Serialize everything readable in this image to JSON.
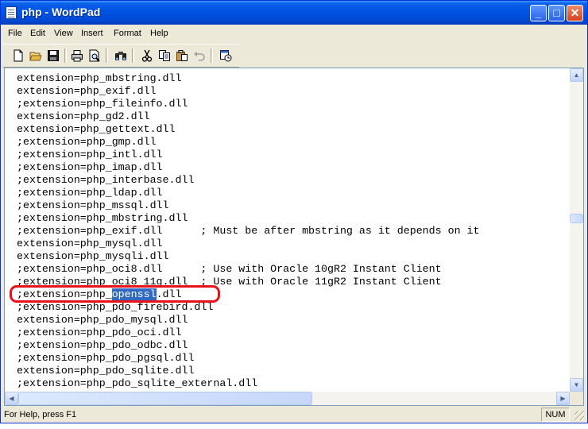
{
  "window": {
    "title": "php - WordPad"
  },
  "titlebar_buttons": {
    "minimize": "_",
    "maximize": "□",
    "close": "✕"
  },
  "menu": [
    "File",
    "Edit",
    "View",
    "Insert",
    "Format",
    "Help"
  ],
  "toolbar": {
    "icons": [
      "new-document-icon",
      "open-folder-icon",
      "save-icon",
      "print-icon",
      "print-preview-icon",
      "find-icon",
      "cut-icon",
      "copy-icon",
      "paste-icon",
      "undo-icon",
      "date-time-icon"
    ]
  },
  "document": {
    "lines": [
      "extension=php_mbstring.dll",
      "extension=php_exif.dll",
      ";extension=php_fileinfo.dll",
      "extension=php_gd2.dll",
      "extension=php_gettext.dll",
      ";extension=php_gmp.dll",
      ";extension=php_intl.dll",
      ";extension=php_imap.dll",
      ";extension=php_interbase.dll",
      ";extension=php_ldap.dll",
      ";extension=php_mssql.dll",
      ";extension=php_mbstring.dll",
      ";extension=php_exif.dll      ; Must be after mbstring as it depends on it",
      "extension=php_mysql.dll",
      "extension=php_mysqli.dll",
      ";extension=php_oci8.dll      ; Use with Oracle 10gR2 Instant Client",
      ";extension=php_oci8_11g.dll  ; Use with Oracle 11gR2 Instant Client",
      {
        "before": ";extension=php_",
        "selected": "openssl",
        "after": ".dll"
      },
      ";extension=php_pdo_firebird.dll",
      "extension=php_pdo_mysql.dll",
      ";extension=php_pdo_oci.dll",
      ";extension=php_pdo_odbc.dll",
      ";extension=php_pdo_pgsql.dll",
      "extension=php_pdo_sqlite.dll",
      ";extension=php_pdo_sqlite_external.dll"
    ]
  },
  "scroll": {
    "vertical_position": 0.46,
    "horizontal_position": 0.0
  },
  "status": {
    "help_text": "For Help, press F1",
    "num_indicator": "NUM"
  },
  "colors": {
    "selection": "#316ac5",
    "annotation": "#e8131b",
    "titlebar": "#0054e3"
  }
}
